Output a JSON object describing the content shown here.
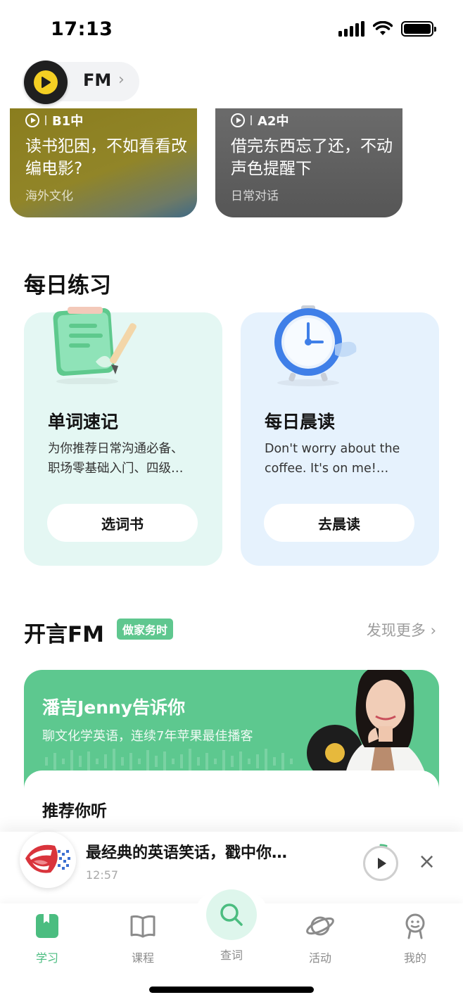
{
  "status_bar": {
    "time": "17:13"
  },
  "fm_pill": {
    "label": "FM"
  },
  "top_cards": [
    {
      "level": "B1中",
      "title": "读书犯困，不如看看改编电影?",
      "tag": "海外文化"
    },
    {
      "level": "A2中",
      "title": "借完东西忘了还，不动声色提醒下",
      "tag": "日常对话"
    }
  ],
  "daily_practice": {
    "title": "每日练习",
    "cards": [
      {
        "title": "单词速记",
        "desc_line1": "为你推荐日常沟通必备、",
        "desc_line2": "职场零基础入门、四级…",
        "button": "选词书"
      },
      {
        "title": "每日晨读",
        "desc_line1": "Don't worry about the",
        "desc_line2": "coffee. It's on me!…",
        "button": "去晨读"
      }
    ]
  },
  "kaiyan_fm": {
    "title": "开言FM",
    "badge": "做家务时",
    "more": "发现更多",
    "feature_title": "潘吉Jenny告诉你",
    "feature_sub": "聊文化学英语，连续7年苹果最佳播客",
    "recommend_title": "推荐你听"
  },
  "mini_player": {
    "title": "最经典的英语笑话，戳中你…",
    "time": "12:57",
    "progress": 0.05
  },
  "tab_bar": {
    "tabs": [
      {
        "label": "学习",
        "icon": "book-filled-icon",
        "active": true
      },
      {
        "label": "课程",
        "icon": "open-book-icon",
        "active": false
      },
      {
        "label": "查词",
        "icon": "search-icon",
        "active": false
      },
      {
        "label": "活动",
        "icon": "planet-icon",
        "active": false
      },
      {
        "label": "我的",
        "icon": "profile-icon",
        "active": false
      }
    ]
  },
  "colors": {
    "accent": "#4bbd80",
    "fm_card": "#5dc88f",
    "practice_green": "#e4f7f3",
    "practice_blue": "#e6f2fd"
  }
}
